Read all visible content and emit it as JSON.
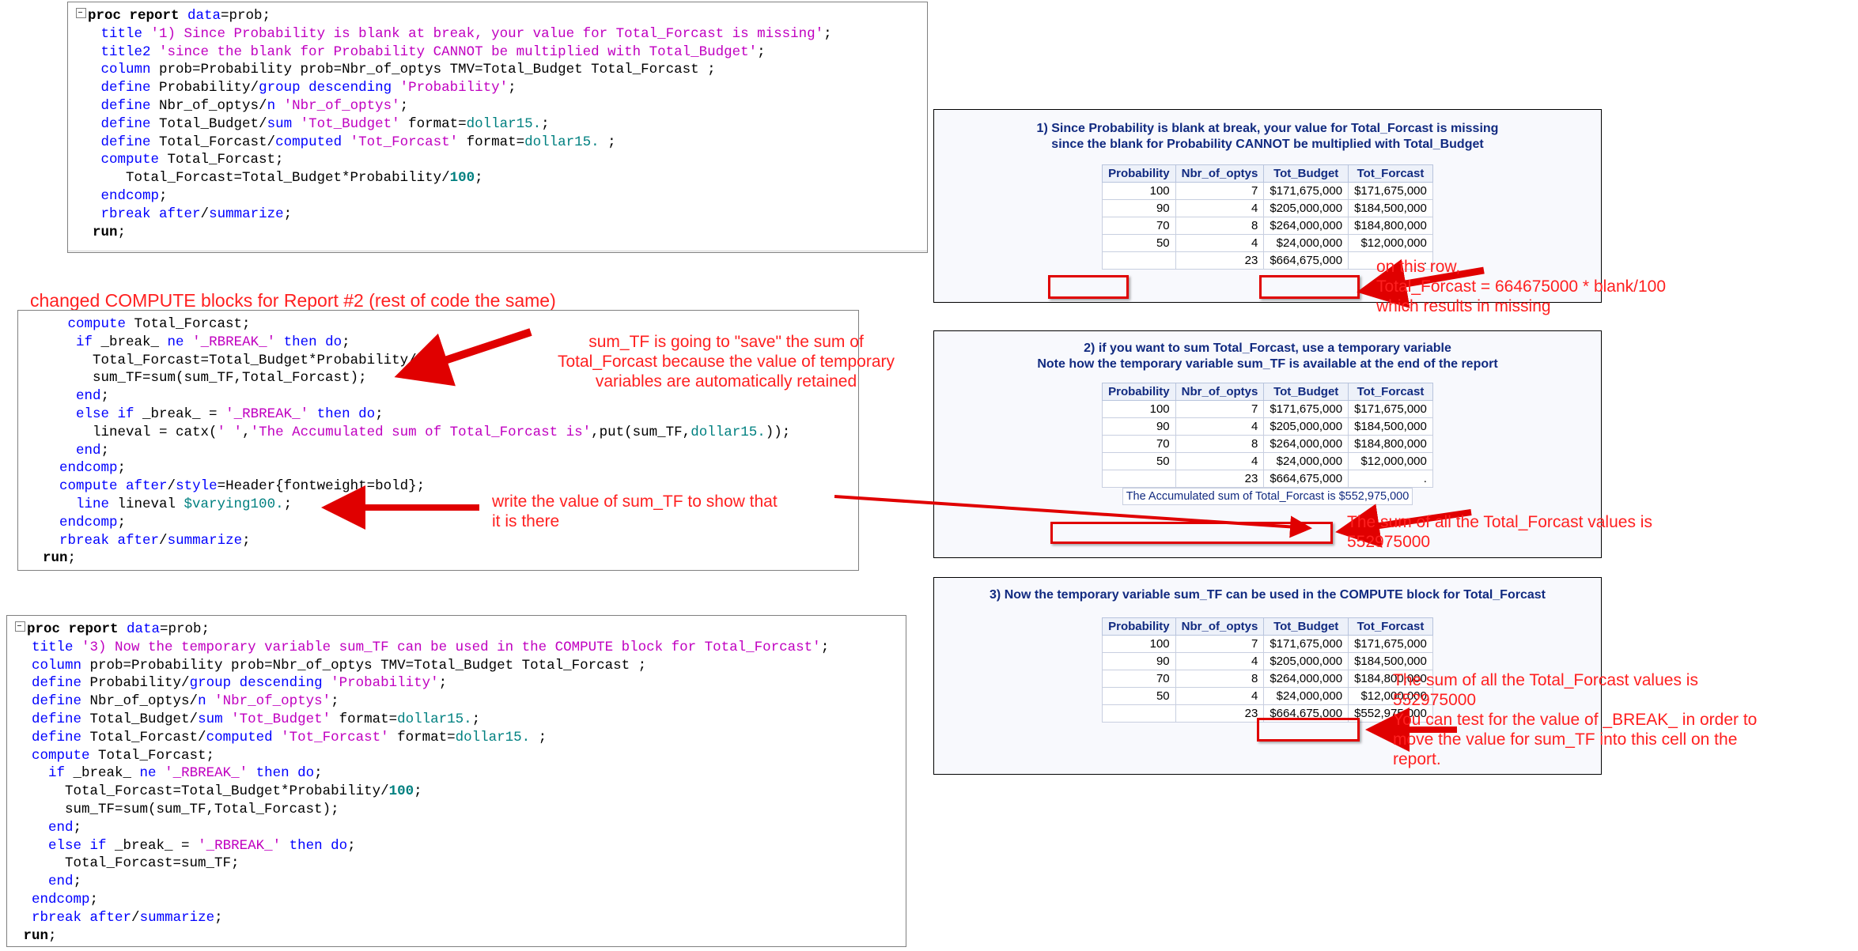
{
  "code_block_1": {
    "name": "proc-report-1",
    "lines": [
      [
        {
          "t": "collapse"
        },
        {
          "t": "bold",
          "s": "proc report "
        },
        {
          "t": "kw",
          "s": "data"
        },
        {
          "t": "blk",
          "s": "=prob;"
        }
      ],
      [
        {
          "t": "blk",
          "s": "   "
        },
        {
          "t": "kw",
          "s": "title "
        },
        {
          "t": "str",
          "s": "'1) Since Probability is blank at break, your value for Total_Forcast is missing'"
        },
        {
          "t": "blk",
          "s": ";"
        }
      ],
      [
        {
          "t": "blk",
          "s": "   "
        },
        {
          "t": "kw",
          "s": "title2 "
        },
        {
          "t": "str",
          "s": "'since the blank for Probability CANNOT be multiplied with Total_Budget'"
        },
        {
          "t": "blk",
          "s": ";"
        }
      ],
      [
        {
          "t": "blk",
          "s": "   "
        },
        {
          "t": "kw",
          "s": "column "
        },
        {
          "t": "blk",
          "s": "prob=Probability prob=Nbr_of_optys TMV=Total_Budget Total_Forcast ;"
        }
      ],
      [
        {
          "t": "blk",
          "s": "   "
        },
        {
          "t": "kw",
          "s": "define "
        },
        {
          "t": "blk",
          "s": "Probability/"
        },
        {
          "t": "kw",
          "s": "group descending "
        },
        {
          "t": "str",
          "s": "'Probability'"
        },
        {
          "t": "blk",
          "s": ";"
        }
      ],
      [
        {
          "t": "blk",
          "s": "   "
        },
        {
          "t": "kw",
          "s": "define "
        },
        {
          "t": "blk",
          "s": "Nbr_of_optys/"
        },
        {
          "t": "kw",
          "s": "n "
        },
        {
          "t": "str",
          "s": "'Nbr_of_optys'"
        },
        {
          "t": "blk",
          "s": ";"
        }
      ],
      [
        {
          "t": "blk",
          "s": "   "
        },
        {
          "t": "kw",
          "s": "define "
        },
        {
          "t": "blk",
          "s": "Total_Budget/"
        },
        {
          "t": "kw",
          "s": "sum "
        },
        {
          "t": "str",
          "s": "'Tot_Budget'"
        },
        {
          "t": "blk",
          "s": " format="
        },
        {
          "t": "fmt",
          "s": "dollar15."
        },
        {
          "t": "blk",
          "s": ";"
        }
      ],
      [
        {
          "t": "blk",
          "s": "   "
        },
        {
          "t": "kw",
          "s": "define "
        },
        {
          "t": "blk",
          "s": "Total_Forcast/"
        },
        {
          "t": "kw",
          "s": "computed "
        },
        {
          "t": "str",
          "s": "'Tot_Forcast'"
        },
        {
          "t": "blk",
          "s": " format="
        },
        {
          "t": "fmt",
          "s": "dollar15."
        },
        {
          "t": "blk",
          "s": " ;"
        }
      ],
      [
        {
          "t": "blk",
          "s": "   "
        },
        {
          "t": "kw",
          "s": "compute "
        },
        {
          "t": "blk",
          "s": "Total_Forcast;"
        }
      ],
      [
        {
          "t": "blk",
          "s": "      Total_Forcast=Total_Budget*Probability/"
        },
        {
          "t": "num",
          "s": "100"
        },
        {
          "t": "blk",
          "s": ";"
        }
      ],
      [
        {
          "t": "blk",
          "s": "   "
        },
        {
          "t": "kw",
          "s": "endcomp"
        },
        {
          "t": "blk",
          "s": ";"
        }
      ],
      [
        {
          "t": "blk",
          "s": "   "
        },
        {
          "t": "kw",
          "s": "rbreak after"
        },
        {
          "t": "blk",
          "s": "/"
        },
        {
          "t": "kw",
          "s": "summarize"
        },
        {
          "t": "blk",
          "s": ";"
        }
      ],
      [
        {
          "t": "blk",
          "s": "  "
        },
        {
          "t": "bold",
          "s": "run"
        },
        {
          "t": "blk",
          "s": ";"
        }
      ]
    ]
  },
  "changed_label": "changed COMPUTE blocks for Report #2 (rest of code the same)",
  "code_block_2": {
    "name": "compute-blocks-2",
    "lines": [
      [
        {
          "t": "blk",
          "s": "     "
        },
        {
          "t": "kw",
          "s": "compute "
        },
        {
          "t": "blk",
          "s": "Total_Forcast;"
        }
      ],
      [
        {
          "t": "blk",
          "s": "      "
        },
        {
          "t": "kw",
          "s": "if "
        },
        {
          "t": "blk",
          "s": "_break_ "
        },
        {
          "t": "kw",
          "s": "ne "
        },
        {
          "t": "str",
          "s": "'_RBREAK_'"
        },
        {
          "t": "blk",
          "s": " "
        },
        {
          "t": "kw",
          "s": "then do"
        },
        {
          "t": "blk",
          "s": ";"
        }
      ],
      [
        {
          "t": "blk",
          "s": "        Total_Forcast=Total_Budget*Probability/"
        },
        {
          "t": "num",
          "s": "100"
        },
        {
          "t": "blk",
          "s": ";"
        }
      ],
      [
        {
          "t": "blk",
          "s": "        sum_TF=sum(sum_TF,Total_Forcast);"
        }
      ],
      [
        {
          "t": "blk",
          "s": "      "
        },
        {
          "t": "kw",
          "s": "end"
        },
        {
          "t": "blk",
          "s": ";"
        }
      ],
      [
        {
          "t": "blk",
          "s": "      "
        },
        {
          "t": "kw",
          "s": "else if "
        },
        {
          "t": "blk",
          "s": "_break_ = "
        },
        {
          "t": "str",
          "s": "'_RBREAK_'"
        },
        {
          "t": "blk",
          "s": " "
        },
        {
          "t": "kw",
          "s": "then do"
        },
        {
          "t": "blk",
          "s": ";"
        }
      ],
      [
        {
          "t": "blk",
          "s": "        lineval = catx("
        },
        {
          "t": "str",
          "s": "' '"
        },
        {
          "t": "blk",
          "s": ","
        },
        {
          "t": "str",
          "s": "'The Accumulated sum of Total_Forcast is'"
        },
        {
          "t": "blk",
          "s": ",put(sum_TF,"
        },
        {
          "t": "fmt",
          "s": "dollar15."
        },
        {
          "t": "blk",
          "s": "));"
        }
      ],
      [
        {
          "t": "blk",
          "s": "      "
        },
        {
          "t": "kw",
          "s": "end"
        },
        {
          "t": "blk",
          "s": ";"
        }
      ],
      [
        {
          "t": "blk",
          "s": "    "
        },
        {
          "t": "kw",
          "s": "endcomp"
        },
        {
          "t": "blk",
          "s": ";"
        }
      ],
      [
        {
          "t": "blk",
          "s": "    "
        },
        {
          "t": "kw",
          "s": "compute after"
        },
        {
          "t": "blk",
          "s": "/"
        },
        {
          "t": "kw",
          "s": "style"
        },
        {
          "t": "blk",
          "s": "=Header{fontweight=bold};"
        }
      ],
      [
        {
          "t": "blk",
          "s": "      "
        },
        {
          "t": "kw",
          "s": "line "
        },
        {
          "t": "blk",
          "s": "lineval "
        },
        {
          "t": "fmt",
          "s": "$varying100."
        },
        {
          "t": "blk",
          "s": ";"
        }
      ],
      [
        {
          "t": "blk",
          "s": "    "
        },
        {
          "t": "kw",
          "s": "endcomp"
        },
        {
          "t": "blk",
          "s": ";"
        }
      ],
      [
        {
          "t": "blk",
          "s": "    "
        },
        {
          "t": "kw",
          "s": "rbreak after"
        },
        {
          "t": "blk",
          "s": "/"
        },
        {
          "t": "kw",
          "s": "summarize"
        },
        {
          "t": "blk",
          "s": ";"
        }
      ],
      [
        {
          "t": "blk",
          "s": "  "
        },
        {
          "t": "bold",
          "s": "run"
        },
        {
          "t": "blk",
          "s": ";"
        }
      ]
    ]
  },
  "code_block_3": {
    "name": "proc-report-3",
    "lines": [
      [
        {
          "t": "collapse"
        },
        {
          "t": "bold",
          "s": "proc report "
        },
        {
          "t": "kw",
          "s": "data"
        },
        {
          "t": "blk",
          "s": "=prob;"
        }
      ],
      [
        {
          "t": "blk",
          "s": "  "
        },
        {
          "t": "kw",
          "s": "title "
        },
        {
          "t": "str",
          "s": "'3) Now the temporary variable sum_TF can be used in the COMPUTE block for Total_Forcast'"
        },
        {
          "t": "blk",
          "s": ";"
        }
      ],
      [
        {
          "t": "blk",
          "s": "  "
        },
        {
          "t": "kw",
          "s": "column "
        },
        {
          "t": "blk",
          "s": "prob=Probability prob=Nbr_of_optys TMV=Total_Budget Total_Forcast ;"
        }
      ],
      [
        {
          "t": "blk",
          "s": "  "
        },
        {
          "t": "kw",
          "s": "define "
        },
        {
          "t": "blk",
          "s": "Probability/"
        },
        {
          "t": "kw",
          "s": "group descending "
        },
        {
          "t": "str",
          "s": "'Probability'"
        },
        {
          "t": "blk",
          "s": ";"
        }
      ],
      [
        {
          "t": "blk",
          "s": "  "
        },
        {
          "t": "kw",
          "s": "define "
        },
        {
          "t": "blk",
          "s": "Nbr_of_optys/"
        },
        {
          "t": "kw",
          "s": "n "
        },
        {
          "t": "str",
          "s": "'Nbr_of_optys'"
        },
        {
          "t": "blk",
          "s": ";"
        }
      ],
      [
        {
          "t": "blk",
          "s": "  "
        },
        {
          "t": "kw",
          "s": "define "
        },
        {
          "t": "blk",
          "s": "Total_Budget/"
        },
        {
          "t": "kw",
          "s": "sum "
        },
        {
          "t": "str",
          "s": "'Tot_Budget'"
        },
        {
          "t": "blk",
          "s": " format="
        },
        {
          "t": "fmt",
          "s": "dollar15."
        },
        {
          "t": "blk",
          "s": ";"
        }
      ],
      [
        {
          "t": "blk",
          "s": "  "
        },
        {
          "t": "kw",
          "s": "define "
        },
        {
          "t": "blk",
          "s": "Total_Forcast/"
        },
        {
          "t": "kw",
          "s": "computed "
        },
        {
          "t": "str",
          "s": "'Tot_Forcast'"
        },
        {
          "t": "blk",
          "s": " format="
        },
        {
          "t": "fmt",
          "s": "dollar15."
        },
        {
          "t": "blk",
          "s": " ;"
        }
      ],
      [
        {
          "t": "blk",
          "s": "  "
        },
        {
          "t": "kw",
          "s": "compute "
        },
        {
          "t": "blk",
          "s": "Total_Forcast;"
        }
      ],
      [
        {
          "t": "blk",
          "s": "    "
        },
        {
          "t": "kw",
          "s": "if "
        },
        {
          "t": "blk",
          "s": "_break_ "
        },
        {
          "t": "kw",
          "s": "ne "
        },
        {
          "t": "str",
          "s": "'_RBREAK_'"
        },
        {
          "t": "blk",
          "s": " "
        },
        {
          "t": "kw",
          "s": "then do"
        },
        {
          "t": "blk",
          "s": ";"
        }
      ],
      [
        {
          "t": "blk",
          "s": "      Total_Forcast=Total_Budget*Probability/"
        },
        {
          "t": "num",
          "s": "100"
        },
        {
          "t": "blk",
          "s": ";"
        }
      ],
      [
        {
          "t": "blk",
          "s": "      sum_TF=sum(sum_TF,Total_Forcast);"
        }
      ],
      [
        {
          "t": "blk",
          "s": "    "
        },
        {
          "t": "kw",
          "s": "end"
        },
        {
          "t": "blk",
          "s": ";"
        }
      ],
      [
        {
          "t": "blk",
          "s": "    "
        },
        {
          "t": "kw",
          "s": "else if "
        },
        {
          "t": "blk",
          "s": "_break_ = "
        },
        {
          "t": "str",
          "s": "'_RBREAK_'"
        },
        {
          "t": "blk",
          "s": " "
        },
        {
          "t": "kw",
          "s": "then do"
        },
        {
          "t": "blk",
          "s": ";"
        }
      ],
      [
        {
          "t": "blk",
          "s": "      Total_Forcast=sum_TF;"
        }
      ],
      [
        {
          "t": "blk",
          "s": "    "
        },
        {
          "t": "kw",
          "s": "end"
        },
        {
          "t": "blk",
          "s": ";"
        }
      ],
      [
        {
          "t": "blk",
          "s": "  "
        },
        {
          "t": "kw",
          "s": "endcomp"
        },
        {
          "t": "blk",
          "s": ";"
        }
      ],
      [
        {
          "t": "blk",
          "s": "  "
        },
        {
          "t": "kw",
          "s": "rbreak after"
        },
        {
          "t": "blk",
          "s": "/"
        },
        {
          "t": "kw",
          "s": "summarize"
        },
        {
          "t": "blk",
          "s": ";"
        }
      ],
      [
        {
          "t": "blk",
          "s": " "
        },
        {
          "t": "bold",
          "s": "run"
        },
        {
          "t": "blk",
          "s": ";"
        }
      ]
    ]
  },
  "reports": [
    {
      "id": "report-1",
      "title_line_1": "1) Since Probability is blank at break, your value for Total_Forcast is missing",
      "title_line_2": "since the blank for Probability CANNOT be multiplied with Total_Budget",
      "columns": [
        "Probability",
        "Nbr_of_optys",
        "Tot_Budget",
        "Tot_Forcast"
      ],
      "rows": [
        [
          "100",
          "7",
          "$171,675,000",
          "$171,675,000"
        ],
        [
          "90",
          "4",
          "$205,000,000",
          "$184,500,000"
        ],
        [
          "70",
          "8",
          "$264,000,000",
          "$184,800,000"
        ],
        [
          "50",
          "4",
          "$24,000,000",
          "$12,000,000"
        ]
      ],
      "summary_row": [
        "",
        "23",
        "$664,675,000",
        "."
      ],
      "lineval": ""
    },
    {
      "id": "report-2",
      "title_line_1": "2) if you want to sum Total_Forcast, use a temporary variable",
      "title_line_2": "Note how the temporary variable sum_TF is available at the end of the report",
      "columns": [
        "Probability",
        "Nbr_of_optys",
        "Tot_Budget",
        "Tot_Forcast"
      ],
      "rows": [
        [
          "100",
          "7",
          "$171,675,000",
          "$171,675,000"
        ],
        [
          "90",
          "4",
          "$205,000,000",
          "$184,500,000"
        ],
        [
          "70",
          "8",
          "$264,000,000",
          "$184,800,000"
        ],
        [
          "50",
          "4",
          "$24,000,000",
          "$12,000,000"
        ]
      ],
      "summary_row": [
        "",
        "23",
        "$664,675,000",
        "."
      ],
      "lineval": "The Accumulated sum of Total_Forcast is $552,975,000"
    },
    {
      "id": "report-3",
      "title_line_1": "3) Now the temporary variable sum_TF can be used in the COMPUTE block for Total_Forcast",
      "title_line_2": "",
      "columns": [
        "Probability",
        "Nbr_of_optys",
        "Tot_Budget",
        "Tot_Forcast"
      ],
      "rows": [
        [
          "100",
          "7",
          "$171,675,000",
          "$171,675,000"
        ],
        [
          "90",
          "4",
          "$205,000,000",
          "$184,500,000"
        ],
        [
          "70",
          "8",
          "$264,000,000",
          "$184,800,000"
        ],
        [
          "50",
          "4",
          "$24,000,000",
          "$12,000,000"
        ]
      ],
      "summary_row": [
        "",
        "23",
        "$664,675,000",
        "$552,975,000"
      ],
      "lineval": ""
    }
  ],
  "annotations": {
    "ann_row_missing": "on this row,\nTotal_Forcast = 664675000 * blank/100\nwhich results in missing",
    "ann_sum_tf_save": "sum_TF is going to \"save\" the sum of\nTotal_Forcast because the value of temporary\nvariables are automatically retained",
    "ann_write_value": "write the value of sum_TF to show that\nit is there",
    "ann_sum_all_1": "The sum of all the Total_Forcast values is\n552975000",
    "ann_sum_all_2": "The sum of all the Total_Forcast values is\n552975000\nYou can test for the value of _BREAK_ in order to\nmove the value for sum_TF into this cell on the\nreport."
  },
  "colors": {
    "annotation_red": "#ff2020",
    "highlight_red": "#e00000",
    "sas_title_blue": "#112a80",
    "code_keyword_blue": "#0000ff",
    "code_string_magenta": "#c000c0",
    "code_format_teal": "#008080"
  }
}
